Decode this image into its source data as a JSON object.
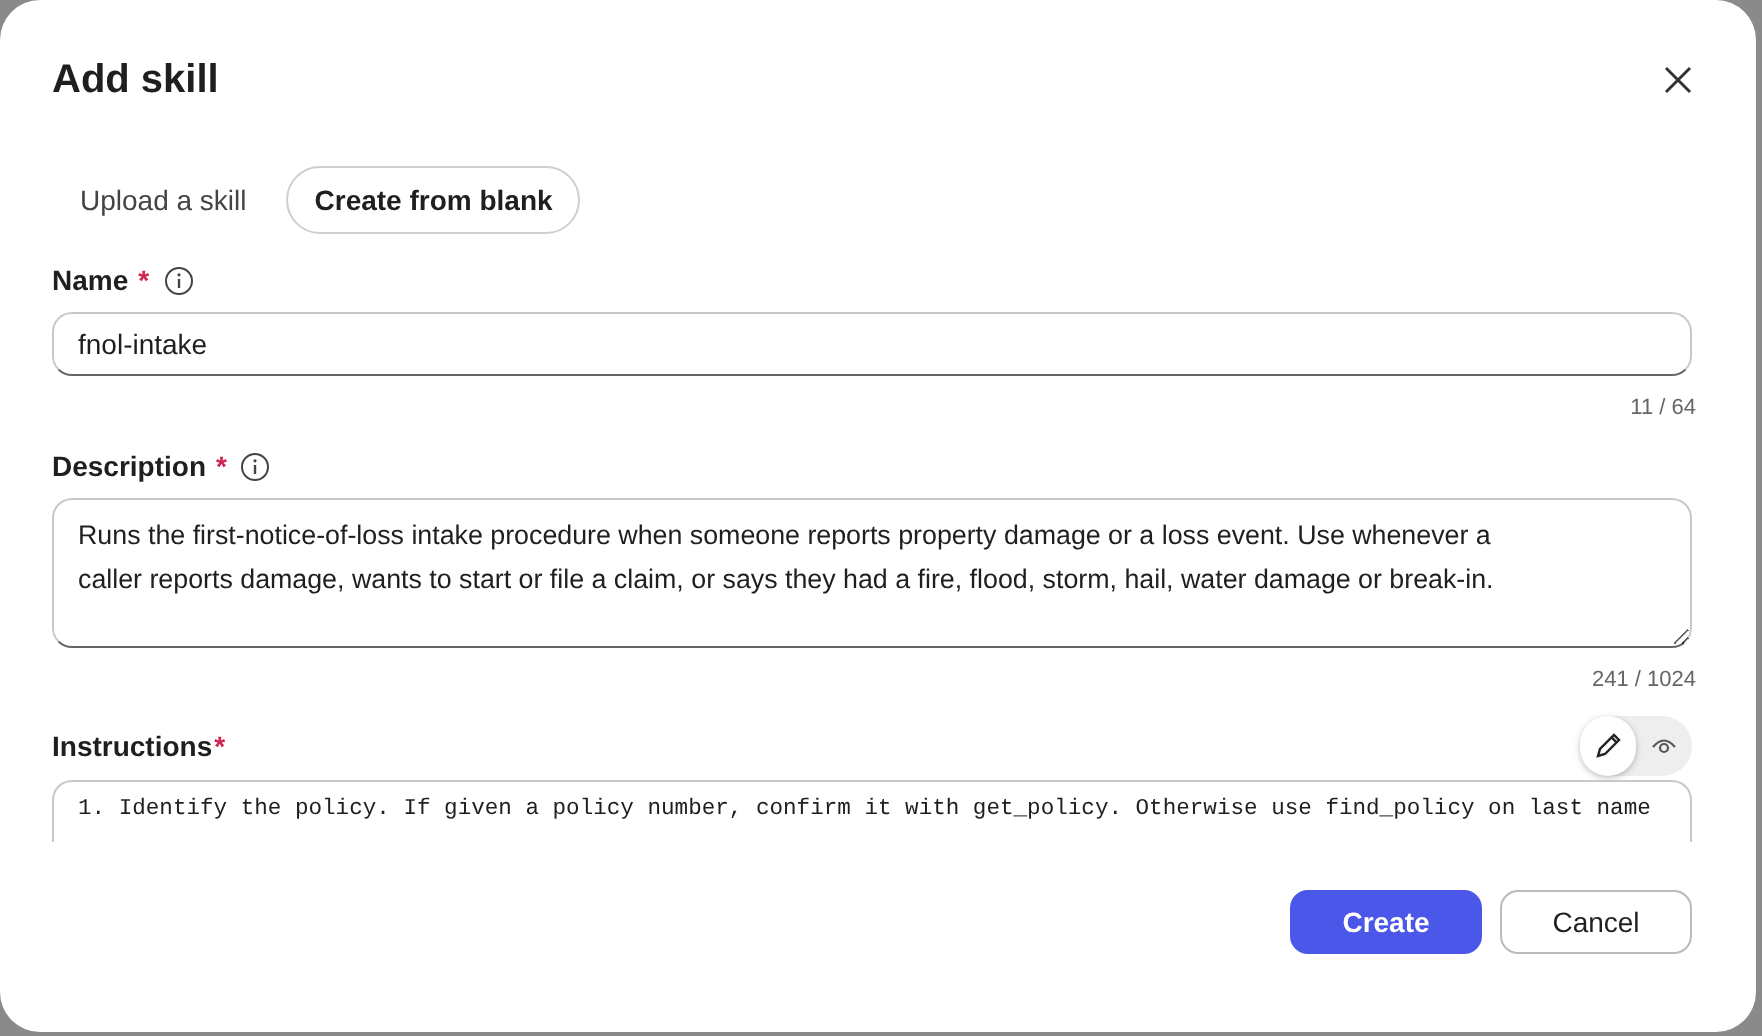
{
  "dialog": {
    "title": "Add skill"
  },
  "tabs": [
    {
      "label": "Upload a skill",
      "selected": false
    },
    {
      "label": "Create from blank",
      "selected": true
    }
  ],
  "name_field": {
    "label": "Name",
    "required_mark": "*",
    "value": "fnol-intake",
    "counter": "11 / 64"
  },
  "description_field": {
    "label": "Description",
    "required_mark": "*",
    "value": "Runs the first-notice-of-loss intake procedure when someone reports property damage or a loss event. Use whenever a caller reports damage, wants to start or file a claim, or says they had a fire, flood, storm, hail, water damage or break-in.",
    "counter": "241 / 1024"
  },
  "instructions_field": {
    "label": "Instructions",
    "required_mark": "*",
    "value": "1. Identify the policy. If given a policy number, confirm it with get_policy. Otherwise use find_policy on last name"
  },
  "mode_toggle": [
    {
      "kind": "edit",
      "selected": true
    },
    {
      "kind": "preview",
      "selected": false
    }
  ],
  "buttons": [
    {
      "label": "Create",
      "kind": "primary"
    },
    {
      "label": "Cancel",
      "kind": "secondary"
    }
  ]
}
